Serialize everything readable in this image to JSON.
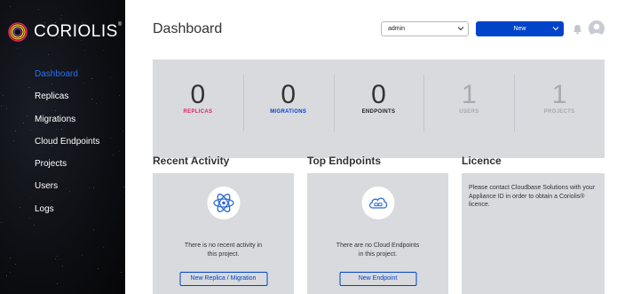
{
  "brand": {
    "name": "CORIOLIS",
    "mark": "®"
  },
  "sidebar": {
    "items": [
      {
        "label": "Dashboard",
        "active": true
      },
      {
        "label": "Replicas"
      },
      {
        "label": "Migrations"
      },
      {
        "label": "Cloud Endpoints"
      },
      {
        "label": "Projects"
      },
      {
        "label": "Users"
      },
      {
        "label": "Logs"
      }
    ]
  },
  "header": {
    "title": "Dashboard",
    "user_select_value": "admin",
    "new_button_label": "New",
    "icons": [
      "bell-icon",
      "avatar"
    ]
  },
  "stats": [
    {
      "value": "0",
      "label": "REPLICAS",
      "color": "#e0245e"
    },
    {
      "value": "0",
      "label": "MIGRATIONS",
      "color": "#0044ca"
    },
    {
      "value": "0",
      "label": "ENDPOINTS",
      "color": "#202020"
    },
    {
      "value": "1",
      "label": "USERS",
      "color": "#a7a9ae"
    },
    {
      "value": "1",
      "label": "PROJECTS",
      "color": "#a7a9ae"
    }
  ],
  "recent_activity": {
    "title": "Recent Activity",
    "message": "There is no recent activity in this project.",
    "button_label": "New Replica / Migration"
  },
  "top_endpoints": {
    "title": "Top Endpoints",
    "message": "There are no Cloud Endpoints in this project.",
    "button_label": "New Endpoint"
  },
  "licence": {
    "title": "Licence",
    "message": "Please contact Cloudbase Solutions with your Appliance ID in order to obtain a Coriolis® licence."
  },
  "colors": {
    "accent": "#0044ca",
    "sidebar_active": "#2a6fe8",
    "panel_bg": "#d8dade",
    "sidebar_bg": "#0d0e12"
  }
}
